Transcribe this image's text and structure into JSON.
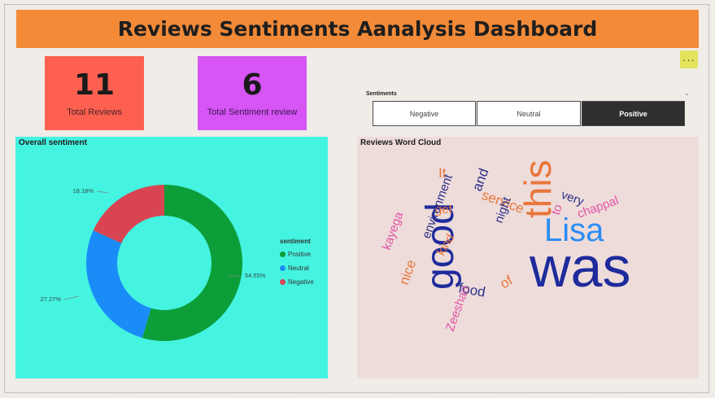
{
  "header": {
    "title": "Reviews Sentiments Aanalysis Dashboard"
  },
  "kpis": [
    {
      "value": "11",
      "label": "Total Reviews",
      "color": "#fd6051"
    },
    {
      "value": "6",
      "label": "Total Sentiment review",
      "color": "#d655f4"
    }
  ],
  "more_button": {
    "label": "···"
  },
  "slicer": {
    "title": "Sentiments",
    "options": [
      "Negative",
      "Neutral",
      "Positive"
    ],
    "selected": "Positive"
  },
  "donut": {
    "title": "Overall sentiment",
    "legend_title": "sentiment"
  },
  "wordcloud": {
    "title": "Reviews Word Cloud"
  },
  "chart_data": [
    {
      "type": "pie",
      "style": "donut",
      "title": "Overall sentiment",
      "legend_title": "sentiment",
      "legend_position": "right",
      "categories": [
        "Positive",
        "Neutral",
        "Negative"
      ],
      "values": [
        54.55,
        27.27,
        18.18
      ],
      "labels": [
        "54.55%",
        "27.27%",
        "18.18%"
      ],
      "colors": [
        "#0c9e39",
        "#1a8cf7",
        "#d94452"
      ]
    },
    {
      "type": "wordcloud",
      "title": "Reviews Word Cloud",
      "words": [
        {
          "text": "was",
          "color": "#1e2b9c"
        },
        {
          "text": "good",
          "color": "#1e2b9c"
        },
        {
          "text": "Lisa",
          "color": "#2b8df3"
        },
        {
          "text": "this",
          "color": "#e8763b"
        },
        {
          "text": "service",
          "color": "#e8763b"
        },
        {
          "text": "chappal",
          "color": "#e053a6"
        },
        {
          "text": "very",
          "color": "#2b2f8a"
        },
        {
          "text": "to",
          "color": "#e053a6"
        },
        {
          "text": "night",
          "color": "#2b2f8a"
        },
        {
          "text": "and",
          "color": "#2b2f8a"
        },
        {
          "text": "It",
          "color": "#e8763b"
        },
        {
          "text": "get",
          "color": "#e8763b"
        },
        {
          "text": "environment",
          "color": "#2b2f8a"
        },
        {
          "text": "kayega",
          "color": "#e053a6"
        },
        {
          "text": "kind",
          "color": "#e8763b"
        },
        {
          "text": "nice",
          "color": "#e8763b"
        },
        {
          "text": "food",
          "color": "#2b2f8a"
        },
        {
          "text": "of",
          "color": "#e8763b"
        },
        {
          "text": "Zeeshan",
          "color": "#e053a6"
        }
      ]
    }
  ]
}
